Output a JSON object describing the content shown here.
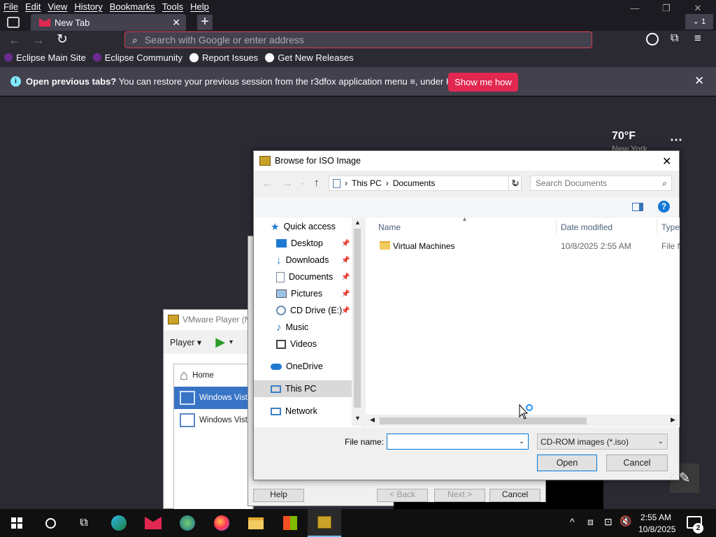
{
  "browser": {
    "menu": [
      "File",
      "Edit",
      "View",
      "History",
      "Bookmarks",
      "Tools",
      "Help"
    ],
    "tab_title": "New Tab",
    "url_placeholder": "Search with Google or enter address",
    "bookmarks": [
      "Eclipse Main Site",
      "Eclipse Community",
      "Report Issues",
      "Get New Releases"
    ],
    "notification": {
      "bold": "Open previous tabs?",
      "text": " You can restore your previous session from the r3dfox application menu",
      "text2": ", under History.",
      "button": "Show me how"
    },
    "weather": {
      "temp": "70°F",
      "city": "New York"
    }
  },
  "vmware": {
    "title": "VMware Player (N",
    "menu": "Player",
    "items": [
      "Home",
      "Windows Vista",
      "Windows Vista"
    ],
    "bottom_buttons": {
      "help": "Help",
      "back": "< Back",
      "next": "Next >",
      "cancel": "Cancel"
    }
  },
  "dialog": {
    "title": "Browse for ISO Image",
    "breadcrumb": [
      "This PC",
      "Documents"
    ],
    "search_placeholder": "Search Documents",
    "nav": [
      {
        "label": "Quick access",
        "icon": "star-icon"
      },
      {
        "label": "Desktop",
        "icon": "desktop-icon",
        "pinned": true
      },
      {
        "label": "Downloads",
        "icon": "downloads-icon",
        "pinned": true
      },
      {
        "label": "Documents",
        "icon": "documents-icon",
        "pinned": true
      },
      {
        "label": "Pictures",
        "icon": "pictures-icon",
        "pinned": true
      },
      {
        "label": "CD Drive (E:)",
        "icon": "cd-drive-icon",
        "pinned": true
      },
      {
        "label": "Music",
        "icon": "music-icon"
      },
      {
        "label": "Videos",
        "icon": "videos-icon"
      },
      {
        "label": "OneDrive",
        "icon": "onedrive-icon"
      },
      {
        "label": "This PC",
        "icon": "pc-icon",
        "selected": true
      },
      {
        "label": "Network",
        "icon": "network-icon"
      }
    ],
    "columns": [
      "Name",
      "Date modified",
      "Type"
    ],
    "files": [
      {
        "name": "Virtual Machines",
        "date": "10/8/2025 2:55 AM",
        "type": "File fo"
      }
    ],
    "filename_label": "File name:",
    "filename_value": "",
    "filetype": "CD-ROM images (*.iso)",
    "open": "Open",
    "cancel": "Cancel"
  },
  "taskbar": {
    "time": "2:55 AM",
    "date": "10/8/2025",
    "notifications": "2"
  },
  "colors": {
    "firefox_dark": "#2b2a33",
    "accent": "#e22850",
    "dialog_bg": "#f0f0f0",
    "selection": "#cce8ff"
  }
}
